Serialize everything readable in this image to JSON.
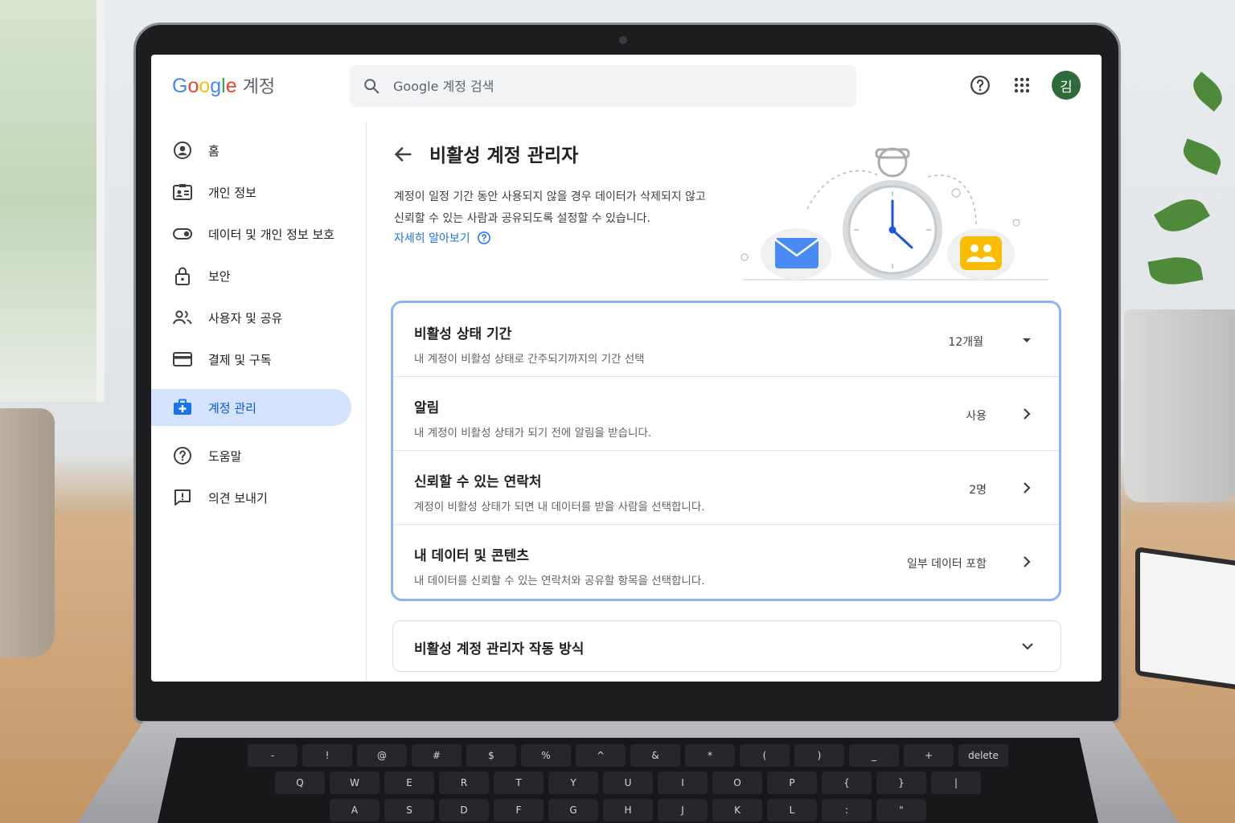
{
  "header": {
    "logo_google": "Google",
    "logo_account": "계정",
    "search_placeholder": "Google 계정 검색",
    "avatar_initial": "김"
  },
  "sidebar": {
    "items": [
      {
        "label": "홈",
        "icon": "account-circle-icon"
      },
      {
        "label": "개인 정보",
        "icon": "id-card-icon"
      },
      {
        "label": "데이터 및 개인 정보 보호",
        "icon": "toggle-icon"
      },
      {
        "label": "보안",
        "icon": "lock-icon"
      },
      {
        "label": "사용자 및 공유",
        "icon": "people-icon"
      },
      {
        "label": "결제 및 구독",
        "icon": "credit-card-icon"
      },
      {
        "label": "계정 관리",
        "icon": "briefcase-icon",
        "active": true
      },
      {
        "label": "도움말",
        "icon": "help-icon"
      },
      {
        "label": "의견 보내기",
        "icon": "feedback-icon"
      }
    ]
  },
  "main": {
    "title": "비활성 계정 관리자",
    "description": "계정이 일정 기간 동안 사용되지 않을 경우 데이터가 삭제되지 않고 신뢰할 수 있는 사람과 공유되도록 설정할 수 있습니다.",
    "learn_more": "자세히 알아보기",
    "settings": [
      {
        "title": "비활성 상태 기간",
        "subtitle": "내 계정이 비활성 상태로 간주되기까지의 기간 선택",
        "value": "12개월",
        "control": "dropdown"
      },
      {
        "title": "알림",
        "subtitle": "내 계정이 비활성 상태가 되기 전에 알림을 받습니다.",
        "value": "사용",
        "control": "chevron"
      },
      {
        "title": "신뢰할 수 있는 연락처",
        "subtitle": "계정이 비활성 상태가 되면 내 데이터를 받을 사람을 선택합니다.",
        "value": "2명",
        "control": "chevron"
      },
      {
        "title": "내 데이터 및 콘텐츠",
        "subtitle": "내 데이터를 신뢰할 수 있는 연락처와 공유할 항목을 선택합니다.",
        "value": "일부 데이터 포함",
        "control": "chevron"
      }
    ],
    "how_it_works": "비활성 계정 관리자 작동 방식"
  },
  "keyboard": {
    "row1": [
      "-",
      "!",
      "@",
      "#",
      "$",
      "%",
      "^",
      "&",
      "*",
      "(",
      ")",
      "_",
      "+",
      "delete"
    ],
    "row2": [
      "Q",
      "W",
      "E",
      "R",
      "T",
      "Y",
      "U",
      "I",
      "O",
      "P",
      "{",
      "}",
      "|"
    ],
    "row3": [
      "A",
      "S",
      "D",
      "F",
      "G",
      "H",
      "J",
      "K",
      "L",
      ":",
      "\""
    ]
  },
  "colors": {
    "accent": "#1a73e8",
    "active_nav_bg": "#d3e3fd",
    "card_border": "#8ab4f8",
    "avatar_bg": "#2e6b3a"
  }
}
